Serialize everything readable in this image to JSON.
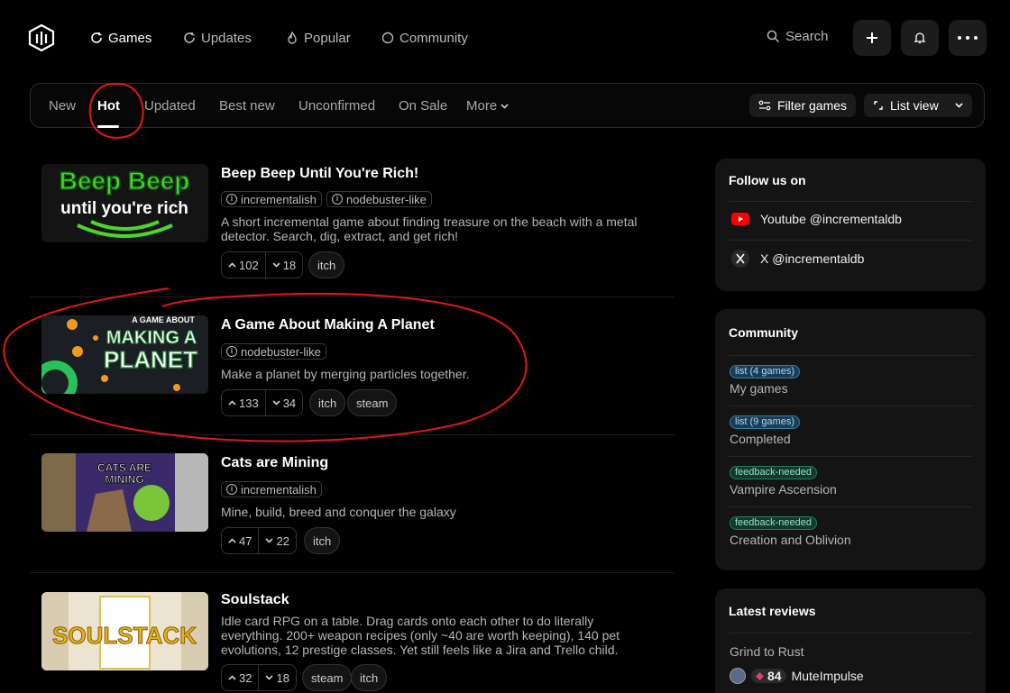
{
  "nav": {
    "items": [
      {
        "label": "Games",
        "icon": "refresh-icon"
      },
      {
        "label": "Updates",
        "icon": "refresh-icon"
      },
      {
        "label": "Popular",
        "icon": "flame-icon"
      },
      {
        "label": "Community",
        "icon": "circle-icon"
      }
    ],
    "search_label": "Search"
  },
  "filter_tabs": [
    "New",
    "Hot",
    "Updated",
    "Best new",
    "Unconfirmed",
    "On Sale",
    "More"
  ],
  "filter_button": "Filter games",
  "view_button": "List view",
  "games": [
    {
      "title": "Beep Beep Until You're Rich!",
      "thumb_text": [
        "Beep Beep",
        "until you're rich"
      ],
      "tags": [
        "incrementalish",
        "nodebuster-like"
      ],
      "description": "A short incremental game about finding treasure on the beach with a metal detector. Search, dig, extract, and get rich!",
      "up": "102",
      "down": "18",
      "platforms": [
        "itch"
      ]
    },
    {
      "title": "A Game About Making A Planet",
      "thumb_text": [
        "A GAME ABOUT",
        "MAKING A",
        "PLANET"
      ],
      "tags": [
        "nodebuster-like"
      ],
      "description": "Make a planet by merging particles together.",
      "up": "133",
      "down": "34",
      "platforms": [
        "itch",
        "steam"
      ]
    },
    {
      "title": "Cats are Mining",
      "thumb_text": [
        "CATS ARE",
        "MINING"
      ],
      "tags": [
        "incrementalish"
      ],
      "description": "Mine, build, breed and conquer the galaxy",
      "up": "47",
      "down": "22",
      "platforms": [
        "itch"
      ]
    },
    {
      "title": "Soulstack",
      "thumb_text": [
        "SOULSTACK"
      ],
      "tags": [],
      "description": "Idle card RPG on a table. Drag cards onto each other to do literally everything. 200+ weapon recipes (only ~40 are worth keeping), 140 pet evolutions, 12 prestige classes. Yet still feels like a Jira and Trello child.",
      "up": "32",
      "down": "18",
      "platforms": [
        "steam",
        "itch"
      ]
    }
  ],
  "sidebar": {
    "follow": {
      "title": "Follow us on",
      "links": [
        {
          "label": "Youtube @incrementaldb",
          "icon": "youtube-icon"
        },
        {
          "label": "X @incrementaldb",
          "icon": "x-icon"
        }
      ]
    },
    "community": {
      "title": "Community",
      "items": [
        {
          "badge": "list (4 games)",
          "type": "list",
          "name": "My games"
        },
        {
          "badge": "list (9 games)",
          "type": "list",
          "name": "Completed"
        },
        {
          "badge": "feedback-needed",
          "type": "fb",
          "name": "Vampire Ascension"
        },
        {
          "badge": "feedback-needed",
          "type": "fb",
          "name": "Creation and Oblivion"
        }
      ]
    },
    "reviews": {
      "title": "Latest reviews",
      "game": "Grind to Rust",
      "score": "84",
      "user": "MuteImpulse"
    }
  },
  "colors": {
    "accent_red": "#e01818",
    "badge_list": "#1a3d55",
    "badge_feedback": "#113a2e"
  }
}
